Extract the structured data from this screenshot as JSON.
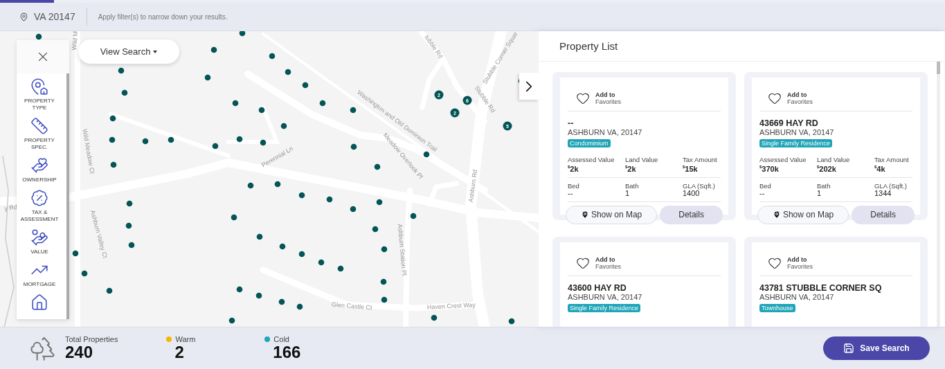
{
  "progress": {
    "level": 0.057
  },
  "header": {
    "location": "VA 20147",
    "hint": "Apply filter(s) to narrow down your results."
  },
  "map": {
    "view_search": "View Search",
    "street_labels": [
      "Wild M",
      "Wild Meadow Ct",
      "Ashburn Valley Ct",
      "y Rd",
      "Perennial Ln",
      "Washington and Old Dominion Trail",
      "Meadow Overlook Pl",
      "Ashburn Rd",
      "Ashburn Station Pl",
      "Glen Castle Ct",
      "Haven Crest Way",
      "tubble Rd",
      "Stubble Rd",
      "Stubble Corner Squar"
    ],
    "clusters": [
      "2",
      "6",
      "2",
      "5"
    ]
  },
  "filter_panel": {
    "items": [
      {
        "label": "PROPERTY TYPE"
      },
      {
        "label": "PROPERTY SPEC."
      },
      {
        "label": "OWNERSHIP"
      },
      {
        "label": "TAX & ASSESSMENT"
      },
      {
        "label": "VALUE"
      },
      {
        "label": "MORTGAGE"
      }
    ]
  },
  "property_list": {
    "title": "Property List",
    "cards": [
      {
        "favorite": "Add to",
        "favorite_sub": "Favorites",
        "address": "--",
        "city": "ASHBURN VA, 20147",
        "type": "Condominium",
        "values": [
          {
            "label": "Assessed Value",
            "currency": "$",
            "value": "2k"
          },
          {
            "label": "Land Value",
            "currency": "$",
            "value": "2k"
          },
          {
            "label": "Tax Amount",
            "currency": "$",
            "value": "15k"
          }
        ],
        "facts": [
          {
            "label": "Bed",
            "value": "--"
          },
          {
            "label": "Bath",
            "value": "1"
          },
          {
            "label": "GLA (Sqft.)",
            "value": "1400"
          }
        ],
        "map_button": "Show on Map",
        "details_button": "Details"
      },
      {
        "favorite": "Add to",
        "favorite_sub": "Favorites",
        "address": "43669 HAY RD",
        "city": "ASHBURN VA, 20147",
        "type": "Single Family Residence",
        "values": [
          {
            "label": "Assessed Value",
            "currency": "$",
            "value": "370k"
          },
          {
            "label": "Land Value",
            "currency": "$",
            "value": "202k"
          },
          {
            "label": "Tax Amount",
            "currency": "$",
            "value": "4k"
          }
        ],
        "facts": [
          {
            "label": "Bed",
            "value": "--"
          },
          {
            "label": "Bath",
            "value": "1"
          },
          {
            "label": "GLA (Sqft.)",
            "value": "1344"
          }
        ],
        "map_button": "Show on Map",
        "details_button": "Details"
      },
      {
        "favorite": "Add to",
        "favorite_sub": "Favorites",
        "address": "43600 HAY RD",
        "city": "ASHBURN VA, 20147",
        "type": "Single Family Residence"
      },
      {
        "favorite": "Add to",
        "favorite_sub": "Favorites",
        "address": "43781 STUBBLE CORNER SQ",
        "city": "ASHBURN VA, 20147",
        "type": "Townhouse"
      }
    ]
  },
  "summary": {
    "total_label": "Total Properties",
    "total": "240",
    "groups": [
      {
        "label": "Warm",
        "count": "2",
        "color": "#f5b800"
      },
      {
        "label": "Cold",
        "count": "166",
        "color": "#1ea5b8"
      }
    ]
  },
  "save_button": "Save Search"
}
